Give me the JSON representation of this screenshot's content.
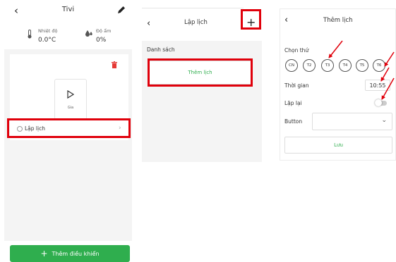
{
  "panel1": {
    "back_icon": "‹",
    "title": "Tivi",
    "temperature": {
      "label": "Nhiệt độ",
      "value": "0.0°C"
    },
    "humidity": {
      "label": "Độ ẩm",
      "value": "0%"
    },
    "device_label": "Gia",
    "schedule_label": "Lập lịch",
    "schedule_chevron": "›",
    "add_button_label": "Thêm điều khiển",
    "add_button_plus": "+"
  },
  "panel2": {
    "back_icon": "‹",
    "title": "Lập lịch",
    "plus_icon": "+",
    "list_label": "Danh sách",
    "add_schedule_label": "Thêm lịch"
  },
  "panel3": {
    "back_icon": "‹",
    "title": "Thêm lịch",
    "choose_day_label": "Chọn thứ",
    "days": [
      "CN",
      "T2",
      "T3",
      "T4",
      "T5",
      "T6"
    ],
    "time_label": "Thời gian",
    "time_value": "10:55",
    "repeat_label": "Lặp lại",
    "repeat_enabled": false,
    "button_label": "Button",
    "select_value": "",
    "select_caret": "⌄",
    "save_label": "Lưu"
  },
  "colors": {
    "accent_green": "#2fae4e",
    "highlight_red": "#e0000b",
    "delete_red": "#e53935"
  }
}
